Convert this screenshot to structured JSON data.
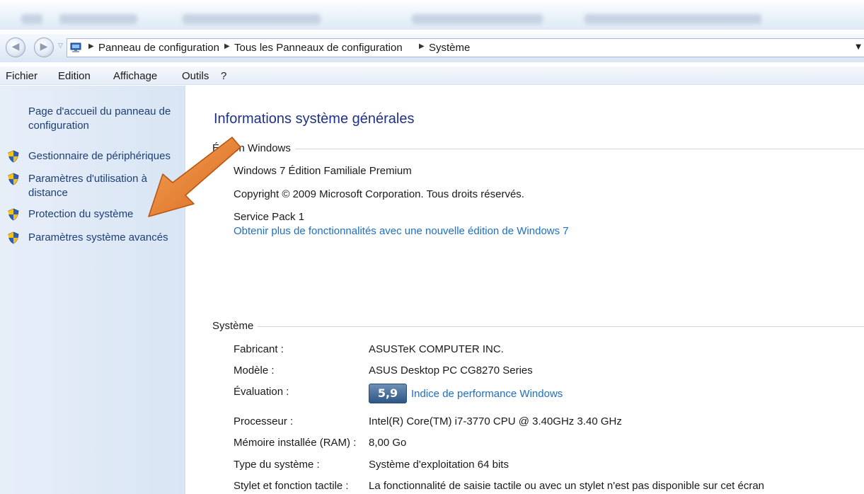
{
  "address_bar": {
    "crumbs": [
      "Panneau de configuration",
      "Tous les Panneaux de configuration",
      "Système"
    ]
  },
  "menu": [
    "Fichier",
    "Edition",
    "Affichage",
    "Outils",
    "?"
  ],
  "left_pane": {
    "home_link": "Page d'accueil du panneau de configuration",
    "tasks": [
      "Gestionnaire de périphériques",
      "Paramètres d'utilisation à distance",
      "Protection du système",
      "Paramètres système avancés"
    ]
  },
  "main": {
    "title": "Informations système générales",
    "edition": {
      "header": "Édition Windows",
      "name": "Windows 7 Édition Familiale Premium",
      "copyright": "Copyright © 2009 Microsoft Corporation. Tous droits réservés.",
      "service_pack": "Service Pack 1",
      "upgrade_link": "Obtenir plus de fonctionnalités avec une nouvelle édition de Windows 7"
    },
    "system": {
      "header": "Système",
      "rows": [
        {
          "label": "Fabricant :",
          "value": "ASUSTeK COMPUTER INC."
        },
        {
          "label": "Modèle :",
          "value": "ASUS Desktop PC CG8270 Series"
        },
        {
          "label": "Évaluation :",
          "value": ""
        },
        {
          "label": "Processeur :",
          "value": "Intel(R) Core(TM) i7-3770 CPU @ 3.40GHz   3.40 GHz"
        },
        {
          "label": "Mémoire installée (RAM) :",
          "value": "8,00 Go"
        },
        {
          "label": "Type du système :",
          "value": "Système d'exploitation 64 bits"
        },
        {
          "label": "Stylet et fonction tactile :",
          "value": "La fonctionnalité de saisie tactile ou avec un stylet n'est pas disponible sur cet écran"
        }
      ],
      "score": "5,9",
      "score_link": "Indice de performance Windows"
    }
  },
  "colors": {
    "link": "#1b6fc7",
    "title": "#1e3287",
    "arrow": "#e87722"
  },
  "icons": {
    "nav_back": "back-arrow-icon",
    "nav_forward": "forward-arrow-icon",
    "location": "computer-icon",
    "tasks": "uac-shield-icon"
  }
}
